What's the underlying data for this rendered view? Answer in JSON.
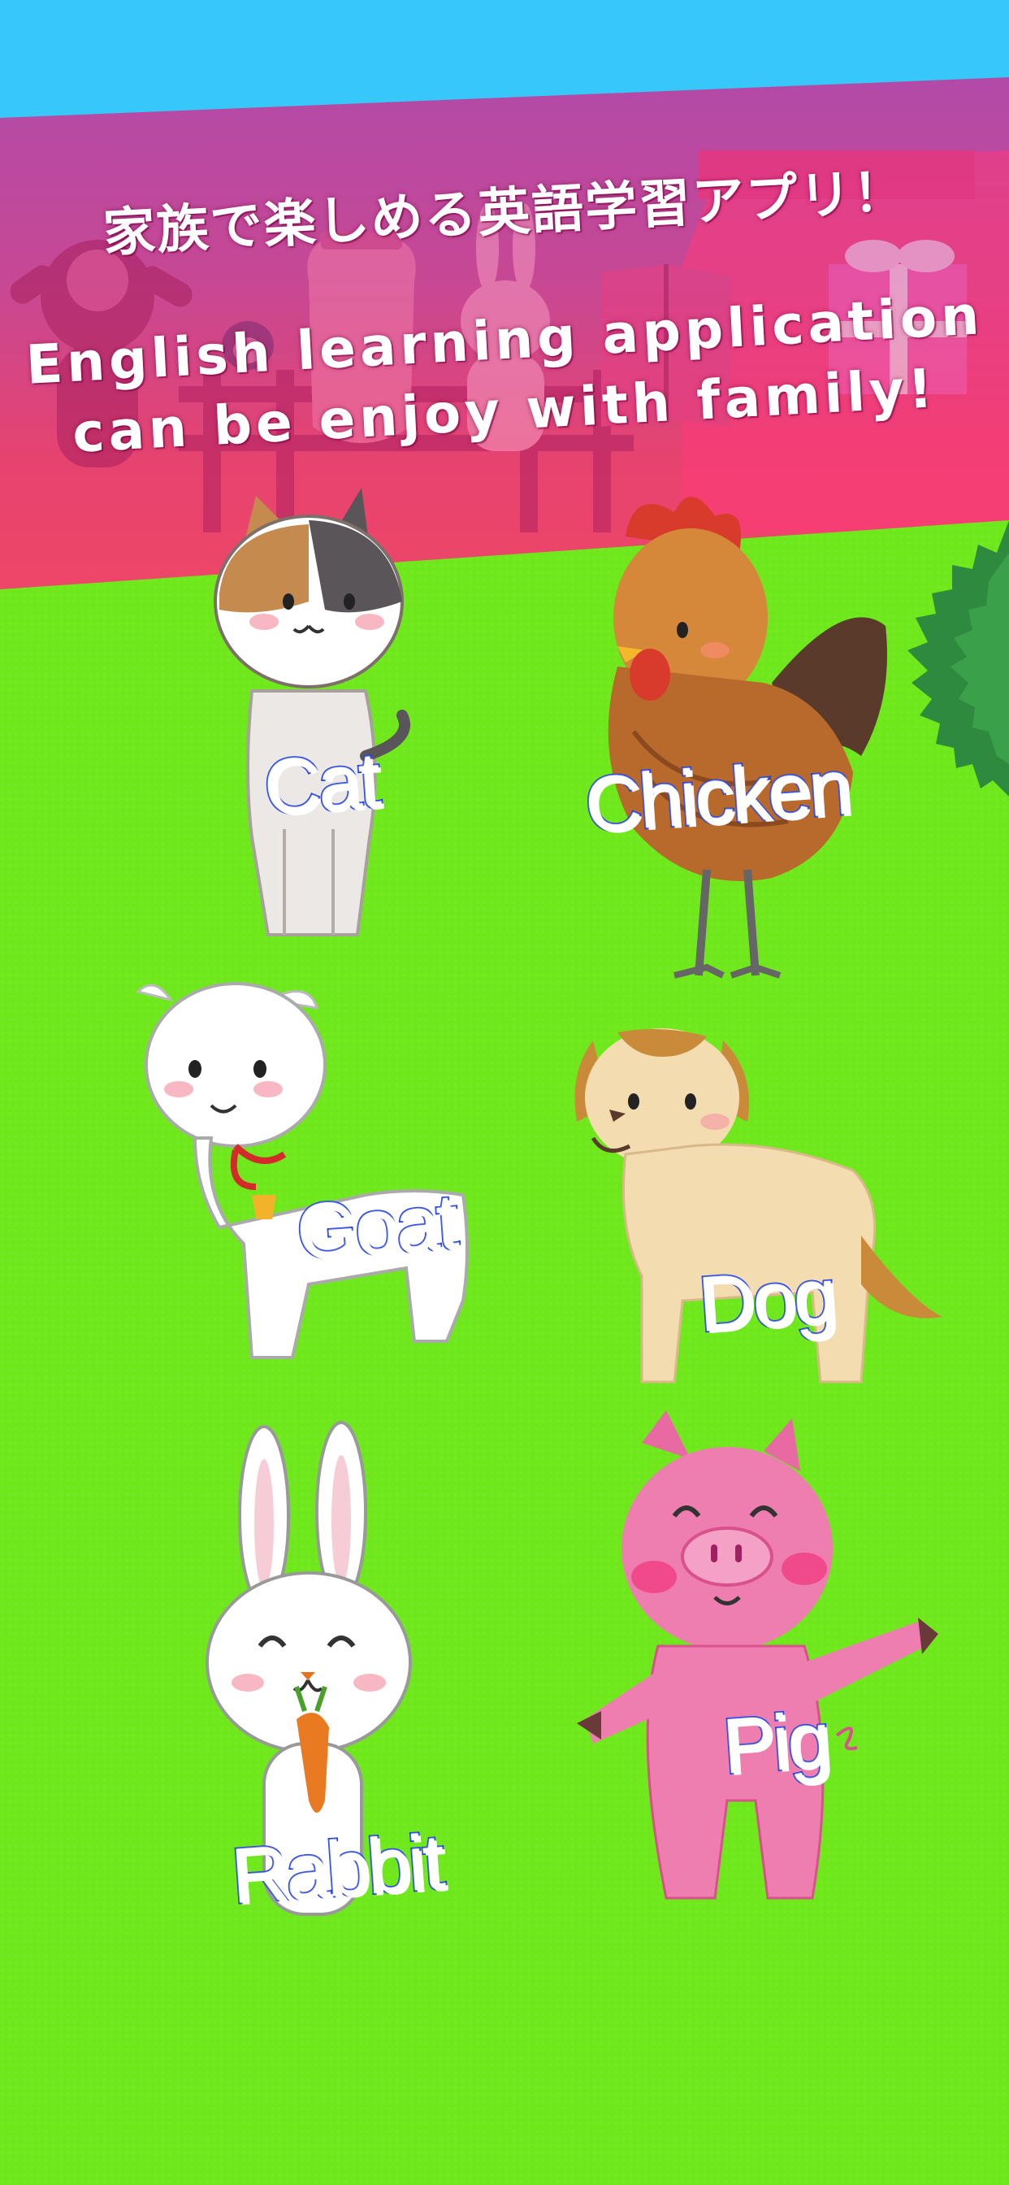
{
  "banner": {
    "japanese_title": "家族で楽しめる英語学習アプリ！",
    "english_line1": "English learning application",
    "english_line2": "can be enjoy with family!"
  },
  "animals": [
    {
      "label": "Cat",
      "icon": "cat-illustration"
    },
    {
      "label": "Chicken",
      "icon": "chicken-illustration"
    },
    {
      "label": "Goat",
      "icon": "goat-illustration"
    },
    {
      "label": "Dog",
      "icon": "dog-illustration"
    },
    {
      "label": "Rabbit",
      "icon": "rabbit-illustration"
    },
    {
      "label": "Pig",
      "icon": "pig-illustration"
    }
  ],
  "colors": {
    "sky": "#35c8f8",
    "grass": "#6ee81a",
    "banner_top": "#b24aa8",
    "banner_bottom": "#ee4668",
    "label_outline": "#1f3fe0"
  }
}
